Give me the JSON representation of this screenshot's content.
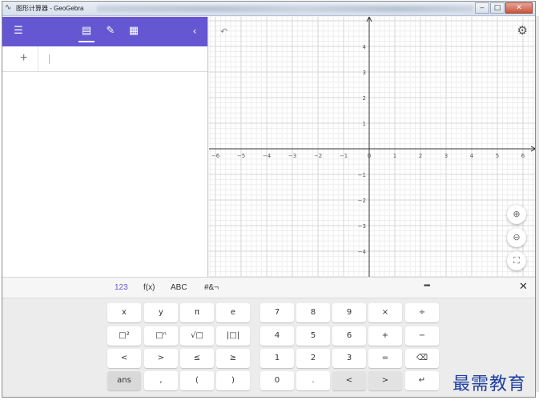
{
  "window": {
    "title": "图形计算器 - GeoGebra",
    "controls": {
      "minimize": "‒",
      "maximize": "□",
      "close": "✕"
    }
  },
  "toolbar": {
    "menu_icon": "menu-icon",
    "tabs": [
      {
        "icon": "algebra-icon",
        "active": true
      },
      {
        "icon": "tools-icon",
        "active": false
      },
      {
        "icon": "table-icon",
        "active": false
      }
    ],
    "collapse_icon": "chevron-left-icon"
  },
  "algebra": {
    "input_value": "",
    "input_placeholder": ""
  },
  "graphics": {
    "x_range": [
      -6,
      6
    ],
    "y_range": [
      -5,
      5
    ],
    "grid": true,
    "x_ticks": [
      "−6",
      "−5",
      "−4",
      "−3",
      "−2",
      "−1",
      "0",
      "1",
      "2",
      "3",
      "4",
      "5",
      "6"
    ],
    "y_ticks": [
      "4",
      "3",
      "2",
      "1",
      "−1",
      "−2",
      "−3",
      "−4"
    ],
    "buttons": [
      "zoom-in-icon",
      "zoom-out-icon",
      "fullscreen-icon"
    ],
    "undo_icon": "undo-icon",
    "settings_icon": "gear-icon"
  },
  "keyboard": {
    "tabs": [
      "123",
      "f(x)",
      "ABC",
      "#&¬"
    ],
    "active_tab": "123",
    "more_label": "•••",
    "close_label": "✕",
    "rows": [
      [
        "x",
        "y",
        "π",
        "e",
        "7",
        "8",
        "9",
        "×",
        "÷"
      ],
      [
        "□²",
        "□ⁿ",
        "√□",
        "|□|",
        "4",
        "5",
        "6",
        "+",
        "−"
      ],
      [
        "<",
        ">",
        "≤",
        "≥",
        "1",
        "2",
        "3",
        "=",
        "⌫"
      ],
      [
        "ans",
        ",",
        "(",
        ")",
        "0",
        ".",
        "<",
        ">",
        "↵"
      ]
    ]
  },
  "watermark": "最需教育",
  "colors": {
    "toolbar": "#6557d2",
    "accent": "#6557d2",
    "grid_minor": "#eeeeee",
    "grid_major": "#d6d6d6",
    "axis": "#333333"
  }
}
